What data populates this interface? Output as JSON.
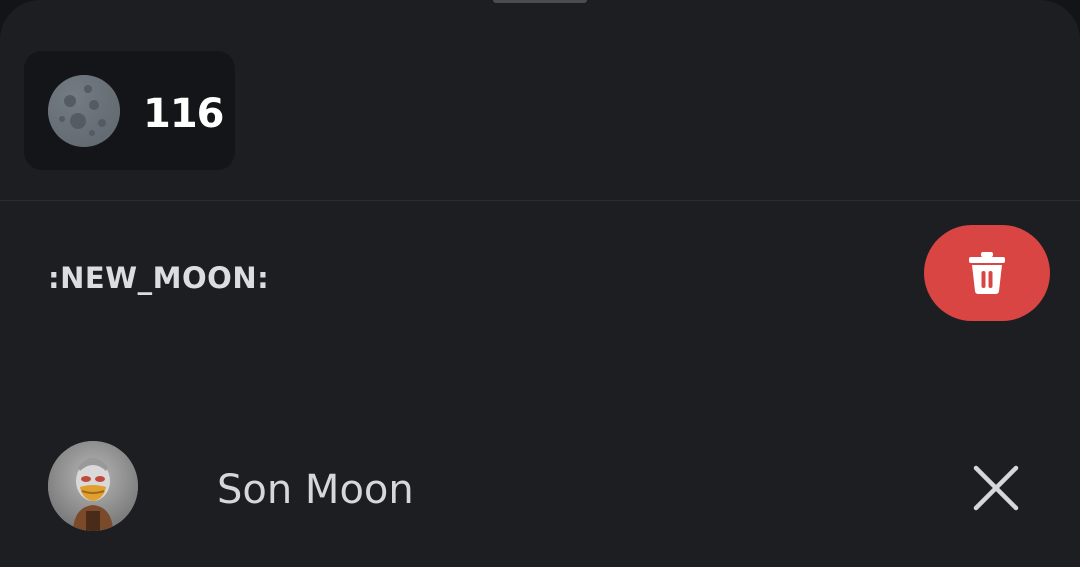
{
  "reaction": {
    "emoji_icon": "new-moon-icon",
    "count": "116"
  },
  "detail": {
    "emoji_name": ":NEW_MOON:",
    "delete_icon": "trash-icon",
    "delete_color": "#d84543"
  },
  "reactor": {
    "avatar_icon": "duck-avatar",
    "name": "Son Moon",
    "remove_icon": "close-icon"
  },
  "colors": {
    "background": "#1d1e22",
    "chip": "#141518",
    "text_primary": "#ffffff",
    "text_secondary": "#d6d7db"
  }
}
